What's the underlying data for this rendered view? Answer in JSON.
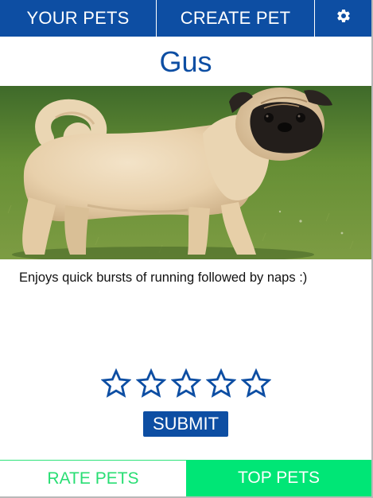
{
  "topnav": {
    "your_pets": "YOUR PETS",
    "create_pet": "CREATE PET",
    "settings_icon": "gear-icon"
  },
  "pet": {
    "name": "Gus",
    "photo_subject": "pug-standing-on-grass",
    "description": "Enjoys quick bursts of running followed by naps :)"
  },
  "rating": {
    "max_stars": 5,
    "selected": 0,
    "star_icon": "star-outline-icon"
  },
  "submit_label": "SUBMIT",
  "bottomnav": {
    "rate_pets": "RATE PETS",
    "top_pets": "TOP PETS",
    "active": "TOP PETS"
  },
  "colors": {
    "primary": "#0d4ea3",
    "accent_green": "#00e676",
    "text_green": "#28de73"
  }
}
